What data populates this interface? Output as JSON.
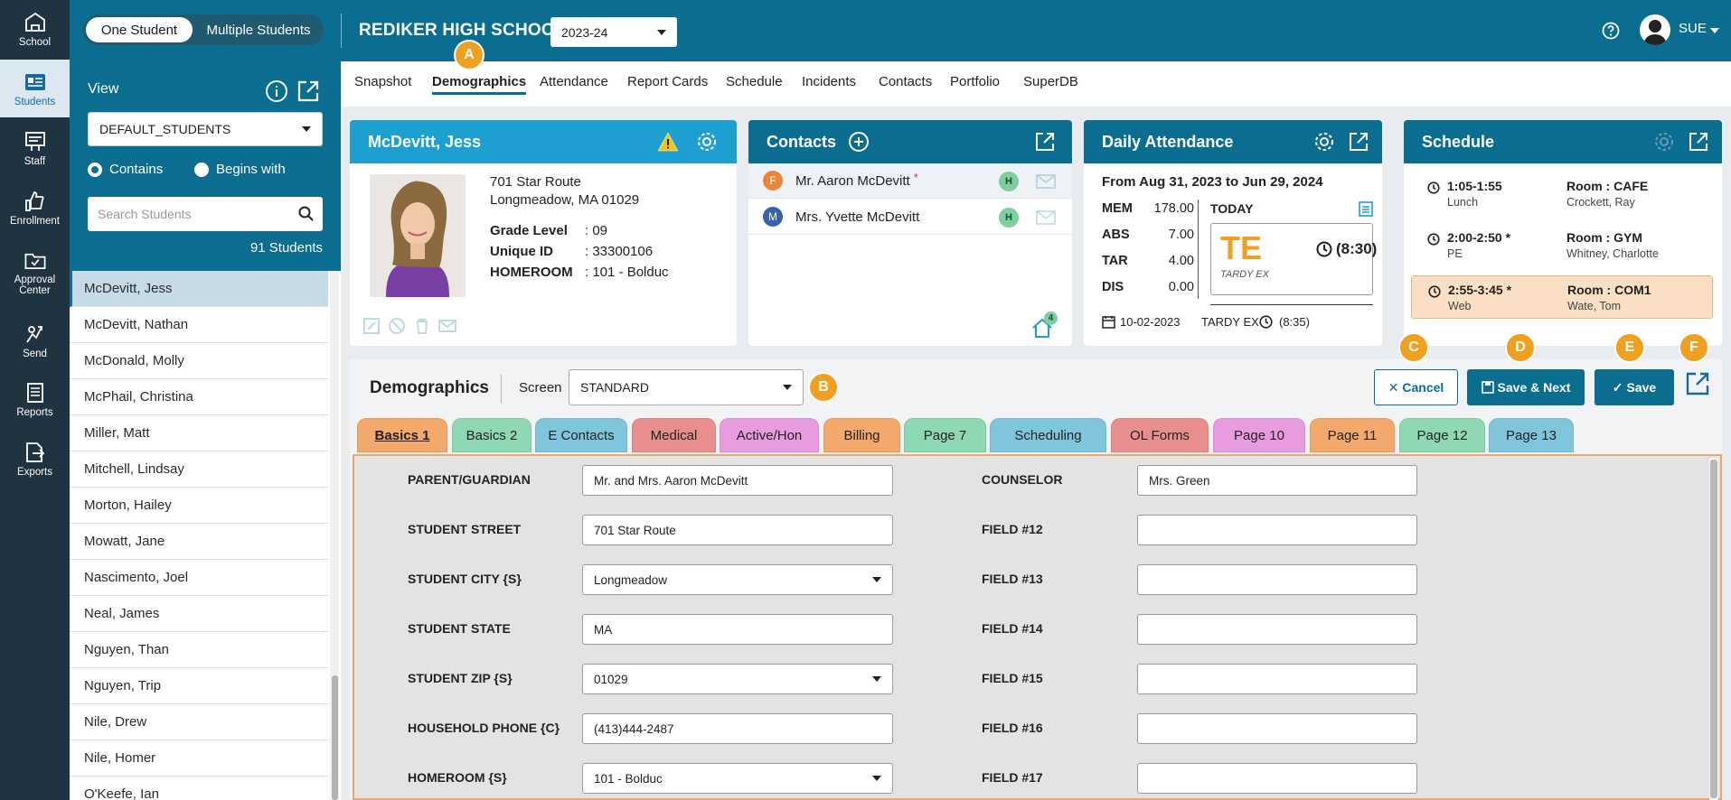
{
  "rail": {
    "items": [
      {
        "label": "School",
        "icon": "school-icon"
      },
      {
        "label": "Students",
        "icon": "students-icon"
      },
      {
        "label": "Staff",
        "icon": "staff-icon"
      },
      {
        "label": "Enrollment",
        "icon": "enrollment-icon"
      },
      {
        "label": "Approval Center",
        "icon": "approval-folder-icon"
      },
      {
        "label": "Send",
        "icon": "send-icon"
      },
      {
        "label": "Reports",
        "icon": "reports-icon"
      },
      {
        "label": "Exports",
        "icon": "exports-icon"
      }
    ]
  },
  "sidebar": {
    "mode_one": "One Student",
    "mode_multi": "Multiple Students",
    "view_label": "View",
    "view_value": "DEFAULT_STUDENTS",
    "contains_label": "Contains",
    "begins_label": "Begins with",
    "search_placeholder": "Search Students",
    "count_text": "91 Students",
    "students": [
      "McDevitt, Jess",
      "McDevitt, Nathan",
      "McDonald, Molly",
      "McPhail, Christina",
      "Miller, Matt",
      "Mitchell, Lindsay",
      "Morton, Hailey",
      "Mowatt, Jane",
      "Nascimento, Joel",
      "Neal, James",
      "Nguyen, Than",
      "Nguyen, Trip",
      "Nile, Drew",
      "Nile, Homer",
      "O'Keefe, Ian"
    ]
  },
  "header": {
    "school": "REDIKER HIGH SCHOOL",
    "year": "2023-24",
    "user": "SUE"
  },
  "nav": {
    "tabs": [
      "Snapshot",
      "Demographics",
      "Attendance",
      "Report Cards",
      "Schedule",
      "Incidents",
      "Contacts",
      "Portfolio",
      "SuperDB"
    ]
  },
  "badges": {
    "a": "A",
    "b": "B",
    "c": "C",
    "d": "D",
    "e": "E",
    "f": "F"
  },
  "student_card": {
    "name": "McDevitt, Jess",
    "street": "701 Star Route",
    "city_line": "Longmeadow, MA 01029",
    "grade_label": "Grade Level",
    "grade_value": ": 09",
    "id_label": "Unique ID",
    "id_value": ": 33300106",
    "homeroom_label": "HOMEROOM",
    "homeroom_value": ": 101 - Bolduc"
  },
  "contacts_card": {
    "title": "Contacts",
    "rows": [
      {
        "initial": "F",
        "name": "Mr. Aaron McDevitt",
        "marker": "*",
        "badge": "H",
        "dot_color": "#e8873a"
      },
      {
        "initial": "M",
        "name": "Mrs. Yvette McDevitt",
        "marker": "",
        "badge": "H",
        "dot_color": "#3a62a8"
      }
    ],
    "home_count": "4"
  },
  "attendance_card": {
    "title": "Daily Attendance",
    "range": "From Aug 31, 2023 to Jun 29, 2024",
    "stats": [
      {
        "k": "MEM",
        "v": "178.00"
      },
      {
        "k": "ABS",
        "v": "7.00"
      },
      {
        "k": "TAR",
        "v": "4.00"
      },
      {
        "k": "DIS",
        "v": "0.00"
      }
    ],
    "today_label": "TODAY",
    "code": "TE",
    "code_time": "(8:30)",
    "code_desc": "TARDY EX",
    "foot_date": "10-02-2023",
    "foot_code": "TARDY EX",
    "foot_time": "(8:35)"
  },
  "schedule_card": {
    "title": "Schedule",
    "rows": [
      {
        "time": "1:05-1:55",
        "course": "Lunch",
        "room": "Room : CAFE",
        "teacher": "Crockett, Ray"
      },
      {
        "time": "2:00-2:50 *",
        "course": "PE",
        "room": "Room : GYM",
        "teacher": "Whitney, Charlotte"
      },
      {
        "time": "2:55-3:45 *",
        "course": "Web",
        "room": "Room : COM1",
        "teacher": "Wate, Tom"
      }
    ]
  },
  "demographics": {
    "title": "Demographics",
    "screen_label": "Screen",
    "screen_value": "STANDARD",
    "cancel": "Cancel",
    "save_next": "Save & Next",
    "save": "Save",
    "tabs": [
      {
        "label": "Basics 1",
        "color": "#f2a96b"
      },
      {
        "label": "Basics 2",
        "color": "#8ed8b3"
      },
      {
        "label": "E Contacts",
        "color": "#7fc6dc"
      },
      {
        "label": "Medical",
        "color": "#e98e8e"
      },
      {
        "label": "Active/Hon",
        "color": "#e99be0"
      },
      {
        "label": "Billing",
        "color": "#f2a96b"
      },
      {
        "label": "Page 7",
        "color": "#8ed8b3"
      },
      {
        "label": "Scheduling",
        "color": "#7fc6dc"
      },
      {
        "label": "OL Forms",
        "color": "#e98e8e"
      },
      {
        "label": "Page 10",
        "color": "#e99be0"
      },
      {
        "label": "Page 11",
        "color": "#f2a96b"
      },
      {
        "label": "Page 12",
        "color": "#8ed8b3"
      },
      {
        "label": "Page 13",
        "color": "#7fc6dc"
      }
    ],
    "left_fields": [
      {
        "label": "PARENT/GUARDIAN",
        "value": "Mr. and Mrs. Aaron McDevitt",
        "dropdown": false
      },
      {
        "label": "STUDENT STREET",
        "value": "701 Star Route",
        "dropdown": false
      },
      {
        "label": "STUDENT CITY {S}",
        "value": "Longmeadow",
        "dropdown": true
      },
      {
        "label": "STUDENT STATE",
        "value": "MA",
        "dropdown": false
      },
      {
        "label": "STUDENT ZIP {S}",
        "value": "01029",
        "dropdown": true
      },
      {
        "label": "HOUSEHOLD PHONE {C}",
        "value": "(413)444-2487",
        "dropdown": false
      },
      {
        "label": "HOMEROOM {S}",
        "value": "101 - Bolduc",
        "dropdown": true
      }
    ],
    "right_fields": [
      {
        "label": "COUNSELOR",
        "value": "Mrs. Green"
      },
      {
        "label": "FIELD #12",
        "value": ""
      },
      {
        "label": "FIELD #13",
        "value": ""
      },
      {
        "label": "FIELD #14",
        "value": ""
      },
      {
        "label": "FIELD #15",
        "value": ""
      },
      {
        "label": "FIELD #16",
        "value": ""
      },
      {
        "label": "FIELD #17",
        "value": ""
      }
    ]
  }
}
